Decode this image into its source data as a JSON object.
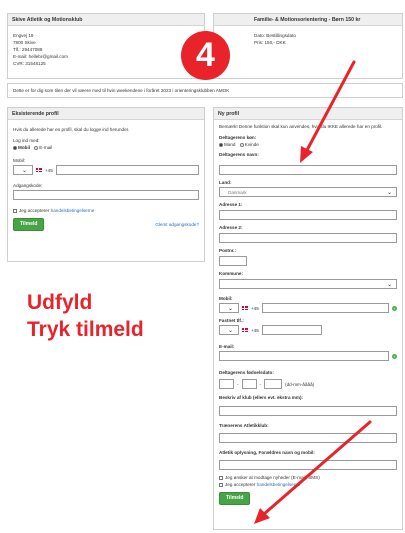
{
  "club": {
    "title": "Skive Atletik og Motionsklub",
    "lines": [
      "Engvej 19",
      "7800 Skive",
      "Tlf.: 29447088",
      "E-mail: hellebr@gmail.com",
      "CVR: 31548125"
    ]
  },
  "event": {
    "title": "Familie- & Motionsorientering - Børn 150 kr",
    "lines": [
      "Dato: Bestillingsdato",
      "Pris: 150,- DKK"
    ]
  },
  "notice": "Dette er for dig som tilen der vil væere med til hvin weekendene i foråret 2023 i orienteringsklubben AMOK",
  "existing": {
    "title": "Eksisterende profil",
    "intro": "Hvis du allerede har en profil, skal du logge ind herunder.",
    "login_with": "Log ind med:",
    "opt_mobil": "Mobil",
    "opt_email": "E-mail",
    "mobil_label": "Mobil:",
    "code": "+45",
    "password_label": "Adgangskode:",
    "accept_prefix": "Jeg accepterer",
    "accept_link": "handelsbetingelserne",
    "submit": "Tilmeld",
    "forgot": "Glemt adgangskode?"
  },
  "annotation": {
    "line1": "Udfyld",
    "line2": "Tryk tilmeld",
    "step": "4"
  },
  "newprofile": {
    "title": "Ny profil",
    "intro": "Bemærk! Denne funktion skal kun anvendes, hvis du IKKE allerede har en profil.",
    "gender_label": "Deltagerens køn:",
    "opt_male": "Mand",
    "opt_female": "Kvinde",
    "name_label": "Deltagerens navn:",
    "country_label": "Land:",
    "country_value": "Danmark",
    "addr1_label": "Adresse 1:",
    "addr2_label": "Adresse 2:",
    "zip_label": "Postnr.:",
    "city_label": "Kommune:",
    "mobil_label": "Mobil:",
    "phone_label": "Fastnet tlf.:",
    "code": "+45",
    "email_label": "E-mail:",
    "birth_label": "Deltagerens fødselsdato:",
    "birth_hint": "(dd-mm-åååå)",
    "club_label": "Beskriv af klub (ellers evt. ekstra mm):",
    "trainer_label": "Trænerens Atletikklub:",
    "info_label": "Atletik oplysning, Forældres navn og mobil:",
    "consent": "Jeg ønsker at modtage nyheder (E-mail, SMS)",
    "accept_prefix": "Jeg accepterer",
    "accept_link": "handelsbetingelserne",
    "submit": "Tilmeld"
  }
}
